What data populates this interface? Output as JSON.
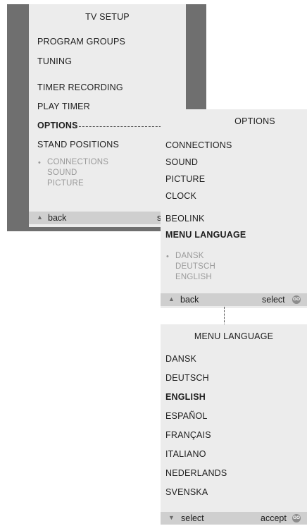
{
  "tv_setup": {
    "title": "TV SETUP",
    "items": [
      "PROGRAM GROUPS",
      "TUNING",
      "TIMER RECORDING",
      "PLAY TIMER",
      "OPTIONS",
      "STAND POSITIONS"
    ],
    "selected": "OPTIONS",
    "sub_items": [
      "CONNECTIONS",
      "SOUND",
      "PICTURE"
    ],
    "footer": {
      "back": "back",
      "select": "selec"
    }
  },
  "options": {
    "title": "OPTIONS",
    "items": [
      "CONNECTIONS",
      "SOUND",
      "PICTURE",
      "CLOCK",
      "BEOLINK",
      "MENU LANGUAGE"
    ],
    "selected": "MENU LANGUAGE",
    "sub_items": [
      "DANSK",
      "DEUTSCH",
      "ENGLISH"
    ],
    "footer": {
      "back": "back",
      "select": "select",
      "go": "GO"
    }
  },
  "menu_language": {
    "title": "MENU LANGUAGE",
    "items": [
      "DANSK",
      "DEUTSCH",
      "ENGLISH",
      "ESPAÑOL",
      "FRANÇAIS",
      "ITALIANO",
      "NEDERLANDS",
      "SVENSKA"
    ],
    "selected": "ENGLISH",
    "footer": {
      "select": "select",
      "accept": "accept",
      "go": "GO"
    }
  },
  "icons": {
    "up_arrow": "up-arrow-icon",
    "down_arrow": "down-arrow-icon",
    "go_button": "go-button-icon",
    "bullet": "bullet-icon"
  }
}
